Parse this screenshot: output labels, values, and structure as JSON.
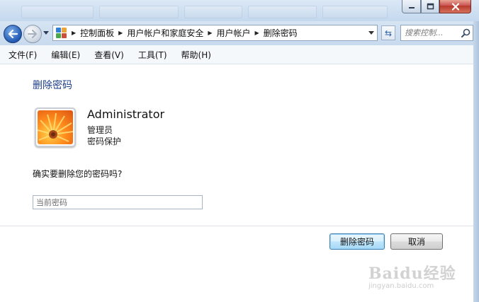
{
  "window": {
    "controls": {
      "minimize_icon": "minimize-icon",
      "maximize_icon": "maximize-icon",
      "close_icon": "close-icon"
    }
  },
  "address": {
    "breadcrumbs": [
      "控制面板",
      "用户帐户和家庭安全",
      "用户帐户",
      "删除密码"
    ],
    "search_placeholder": "搜索控制..."
  },
  "menu": [
    "文件(F)",
    "编辑(E)",
    "查看(V)",
    "工具(T)",
    "帮助(H)"
  ],
  "page": {
    "title": "删除密码",
    "user": {
      "name": "Administrator",
      "role": "管理员",
      "status": "密码保护"
    },
    "question": "确实要删除您的密码吗?",
    "password_placeholder": "当前密码",
    "password_value": ""
  },
  "buttons": {
    "confirm": "删除密码",
    "cancel": "取消"
  },
  "watermark": {
    "brand": "Baidu经验",
    "url": "jingyan.baidu.com"
  },
  "colors": {
    "heading": "#1e3f8a",
    "primary_button_border": "#3c7fb1",
    "content_bg": "#ffffff",
    "chrome_bg": "#cfe0f1"
  }
}
